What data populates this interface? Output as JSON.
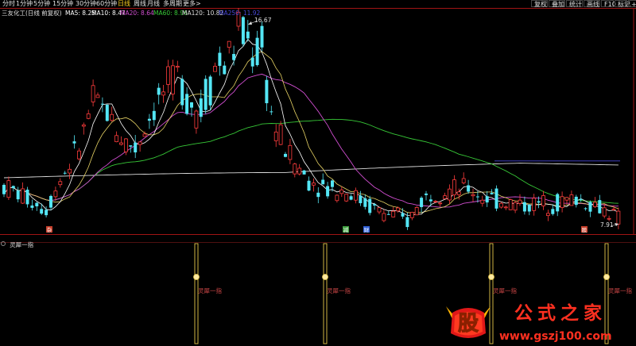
{
  "toolbar": {
    "periods": [
      "分时",
      "1分钟",
      "5分钟",
      "15分钟",
      "30分钟",
      "60分钟",
      "日线",
      "周线",
      "月线",
      "多周期",
      "更多>"
    ],
    "active_period": "日线",
    "right_buttons": [
      "复权",
      "叠加",
      "统计",
      "画线",
      "F10",
      "标记",
      "+自"
    ]
  },
  "main_chart": {
    "stock_title": "三友化工(日线 前复权)",
    "ma_legend": [
      {
        "label": "MA5: 8.25",
        "color": "#ffffff"
      },
      {
        "label": "MA10: 8.47",
        "color": "#ffffff"
      },
      {
        "label": "MA20: 8.64",
        "color": "#d14ed1"
      },
      {
        "label": "MA60: 8.96",
        "color": "#37c837"
      },
      {
        "label": "MA120: 10.82",
        "color": "#dcdcdc"
      },
      {
        "label": "MA250: 11.92",
        "color": "#4848d8"
      }
    ],
    "high_label": "16.67",
    "low_label": "7.91",
    "markers": [
      {
        "text": "杂",
        "color": "#c8402c"
      },
      {
        "text": "减",
        "color": "#3fa03f"
      },
      {
        "text": "财",
        "color": "#3060d8"
      },
      {
        "text": "股",
        "color": "#c8402c"
      }
    ]
  },
  "sub_chart": {
    "indicator_name": "灵犀一指",
    "signal_label": "灵犀一指",
    "signal_count": 4
  },
  "watermark": {
    "logo_char": "股",
    "brand": "公式之家",
    "url": "www.gszj100.com"
  },
  "colors": {
    "up": "#ff3c3c",
    "down": "#54e6f5",
    "axis": "#a01414",
    "ma5": "#ffffff",
    "ma10": "#e6d264",
    "ma20": "#d14ed1",
    "ma60": "#37c837",
    "ma120": "#dcdcdc",
    "ma250": "#4848d8",
    "signal": "#e6c84a"
  }
}
